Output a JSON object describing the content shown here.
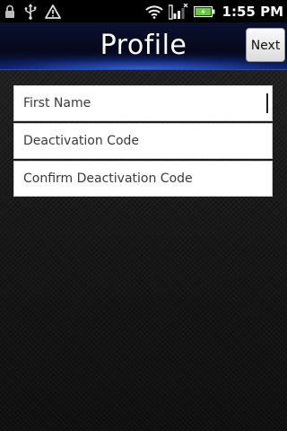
{
  "status_bar": {
    "time": "1:55 PM",
    "icons": [
      "lock-icon",
      "usb-icon",
      "warning-icon",
      "wifi-icon",
      "signal-icon",
      "battery-icon"
    ]
  },
  "header": {
    "title": "Profile",
    "next_label": "Next"
  },
  "form": {
    "fields": [
      {
        "placeholder": "First Name",
        "focused": true
      },
      {
        "placeholder": "Deactivation Code",
        "focused": false
      },
      {
        "placeholder": "Confirm Deactivation Code",
        "focused": false
      }
    ]
  },
  "colors": {
    "status_bar_bg": "#000000",
    "title_bar_accent": "#3c78ff",
    "field_bg": "#ffffff",
    "button_bg": "#f0f0f0"
  }
}
